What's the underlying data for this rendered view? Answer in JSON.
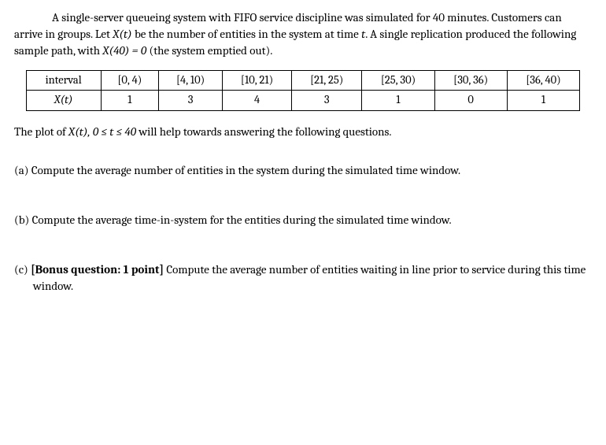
{
  "intro": {
    "p1a": "A single-server queueing system with FIFO service discipline was simulated for 40 minutes. Customers can arrive in groups. Let ",
    "Xt": "X(t)",
    "p1b": " be the number of entities in the system at time ",
    "tvar": "t",
    "p1c": ". A single replication produced the following sample path, with ",
    "cond": "X(40) = 0",
    "p1d": " (the system emptied out)."
  },
  "table": {
    "row1": {
      "label": "interval",
      "c1": "[0, 4)",
      "c2": "[4, 10)",
      "c3": "[10, 21)",
      "c4": "[21, 25)",
      "c5": "[25, 30)",
      "c6": "[30, 36)",
      "c7": "[36, 40)"
    },
    "row2": {
      "label": "X(t)",
      "c1": "1",
      "c2": "3",
      "c3": "4",
      "c4": "3",
      "c5": "1",
      "c6": "0",
      "c7": "1"
    }
  },
  "hint": {
    "a": "The plot of ",
    "fn": "X(t), 0 ≤ t ≤ 40",
    "b": " will help towards answering the following questions."
  },
  "qa": {
    "label": "(a) ",
    "text": "Compute the average number of entities in the system during the simulated time window."
  },
  "qb": {
    "label": "(b) ",
    "text": "Compute the average time-in-system for the entities during the simulated time window."
  },
  "qc": {
    "label": "(c) ",
    "bonus": "[Bonus question: 1 point]",
    "text": " Compute the average number of entities waiting in line prior to service during this time window."
  }
}
